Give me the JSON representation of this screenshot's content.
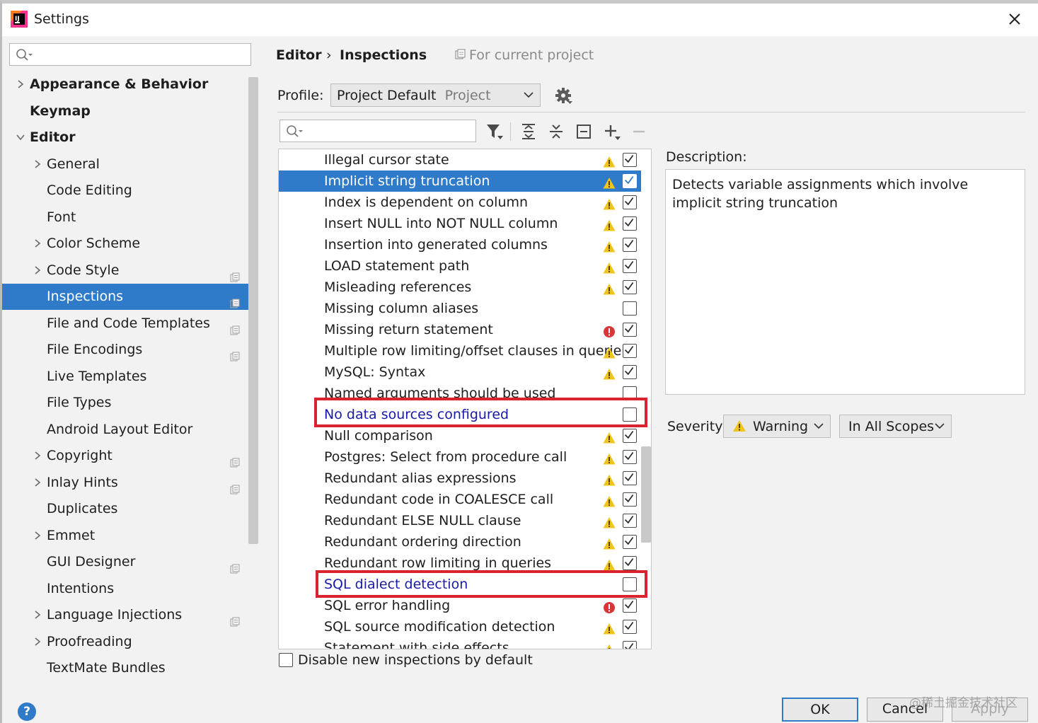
{
  "window": {
    "title": "Settings"
  },
  "sidebar": {
    "search_placeholder": "",
    "items": [
      {
        "label": "Appearance & Behavior",
        "level": 0,
        "bold": true,
        "expandable": true,
        "expanded": false,
        "proj": false
      },
      {
        "label": "Keymap",
        "level": 0,
        "bold": true,
        "expandable": false,
        "expanded": false,
        "proj": false
      },
      {
        "label": "Editor",
        "level": 0,
        "bold": true,
        "expandable": true,
        "expanded": true,
        "proj": false
      },
      {
        "label": "General",
        "level": 1,
        "bold": false,
        "expandable": true,
        "expanded": false,
        "proj": false
      },
      {
        "label": "Code Editing",
        "level": 1,
        "bold": false,
        "expandable": false,
        "expanded": false,
        "proj": false
      },
      {
        "label": "Font",
        "level": 1,
        "bold": false,
        "expandable": false,
        "expanded": false,
        "proj": false
      },
      {
        "label": "Color Scheme",
        "level": 1,
        "bold": false,
        "expandable": true,
        "expanded": false,
        "proj": false
      },
      {
        "label": "Code Style",
        "level": 1,
        "bold": false,
        "expandable": true,
        "expanded": false,
        "proj": true
      },
      {
        "label": "Inspections",
        "level": 1,
        "bold": false,
        "expandable": false,
        "expanded": false,
        "proj": true,
        "selected": true
      },
      {
        "label": "File and Code Templates",
        "level": 1,
        "bold": false,
        "expandable": false,
        "expanded": false,
        "proj": true
      },
      {
        "label": "File Encodings",
        "level": 1,
        "bold": false,
        "expandable": false,
        "expanded": false,
        "proj": true
      },
      {
        "label": "Live Templates",
        "level": 1,
        "bold": false,
        "expandable": false,
        "expanded": false,
        "proj": false
      },
      {
        "label": "File Types",
        "level": 1,
        "bold": false,
        "expandable": false,
        "expanded": false,
        "proj": false
      },
      {
        "label": "Android Layout Editor",
        "level": 1,
        "bold": false,
        "expandable": false,
        "expanded": false,
        "proj": false
      },
      {
        "label": "Copyright",
        "level": 1,
        "bold": false,
        "expandable": true,
        "expanded": false,
        "proj": true
      },
      {
        "label": "Inlay Hints",
        "level": 1,
        "bold": false,
        "expandable": true,
        "expanded": false,
        "proj": true
      },
      {
        "label": "Duplicates",
        "level": 1,
        "bold": false,
        "expandable": false,
        "expanded": false,
        "proj": false
      },
      {
        "label": "Emmet",
        "level": 1,
        "bold": false,
        "expandable": true,
        "expanded": false,
        "proj": false
      },
      {
        "label": "GUI Designer",
        "level": 1,
        "bold": false,
        "expandable": false,
        "expanded": false,
        "proj": true
      },
      {
        "label": "Intentions",
        "level": 1,
        "bold": false,
        "expandable": false,
        "expanded": false,
        "proj": false
      },
      {
        "label": "Language Injections",
        "level": 1,
        "bold": false,
        "expandable": true,
        "expanded": false,
        "proj": true
      },
      {
        "label": "Proofreading",
        "level": 1,
        "bold": false,
        "expandable": true,
        "expanded": false,
        "proj": false
      },
      {
        "label": "TextMate Bundles",
        "level": 1,
        "bold": false,
        "expandable": false,
        "expanded": false,
        "proj": false
      }
    ]
  },
  "breadcrumb": {
    "parent": "Editor",
    "separator": "›",
    "current": "Inspections",
    "scope": "For current project"
  },
  "profile": {
    "label": "Profile:",
    "value": "Project Default",
    "sub": "Project"
  },
  "inspections": [
    {
      "name": "Illegal cursor state",
      "severity": "warning",
      "checked": true
    },
    {
      "name": "Implicit string truncation",
      "severity": "warning",
      "checked": true,
      "selected": true
    },
    {
      "name": "Index is dependent on column",
      "severity": "warning",
      "checked": true
    },
    {
      "name": "Insert NULL into NOT NULL column",
      "severity": "warning",
      "checked": true
    },
    {
      "name": "Insertion into generated columns",
      "severity": "warning",
      "checked": true
    },
    {
      "name": "LOAD statement path",
      "severity": "warning",
      "checked": true
    },
    {
      "name": "Misleading references",
      "severity": "warning",
      "checked": true
    },
    {
      "name": "Missing column aliases",
      "severity": "none",
      "checked": false
    },
    {
      "name": "Missing return statement",
      "severity": "error",
      "checked": true
    },
    {
      "name": "Multiple row limiting/offset clauses in querie",
      "severity": "warning",
      "checked": true
    },
    {
      "name": "MySQL: Syntax",
      "severity": "warning",
      "checked": true
    },
    {
      "name": "Named arguments should be used",
      "severity": "none",
      "checked": false
    },
    {
      "name": "No data sources configured",
      "severity": "none",
      "checked": false,
      "link": true
    },
    {
      "name": "Null comparison",
      "severity": "warning",
      "checked": true
    },
    {
      "name": "Postgres: Select from procedure call",
      "severity": "warning",
      "checked": true
    },
    {
      "name": "Redundant alias expressions",
      "severity": "warning",
      "checked": true
    },
    {
      "name": "Redundant code in COALESCE call",
      "severity": "warning",
      "checked": true
    },
    {
      "name": "Redundant ELSE NULL clause",
      "severity": "warning",
      "checked": true
    },
    {
      "name": "Redundant ordering direction",
      "severity": "warning",
      "checked": true
    },
    {
      "name": "Redundant row limiting in queries",
      "severity": "warning",
      "checked": true
    },
    {
      "name": "SQL dialect detection",
      "severity": "none",
      "checked": false,
      "link": true
    },
    {
      "name": "SQL error handling",
      "severity": "error",
      "checked": true
    },
    {
      "name": "SQL source modification detection",
      "severity": "warning",
      "checked": true
    },
    {
      "name": "Statement with side effects",
      "severity": "warning",
      "checked": true
    }
  ],
  "description": {
    "label": "Description:",
    "text": "Detects variable assignments which involve implicit string truncation"
  },
  "severity": {
    "label": "Severity:",
    "value": "Warning",
    "scope": "In All Scopes"
  },
  "bottom": {
    "disable_new_label": "Disable new inspections by default"
  },
  "buttons": {
    "help": "?",
    "ok": "OK",
    "cancel": "Cancel",
    "apply": "Apply"
  },
  "watermark": "@稀土掘金技术社区",
  "colors": {
    "selection": "#2f7bc9",
    "warning": "#f0c419",
    "error": "#d9343a",
    "highlight_box": "#d9232e",
    "link": "#1a1aa8"
  }
}
